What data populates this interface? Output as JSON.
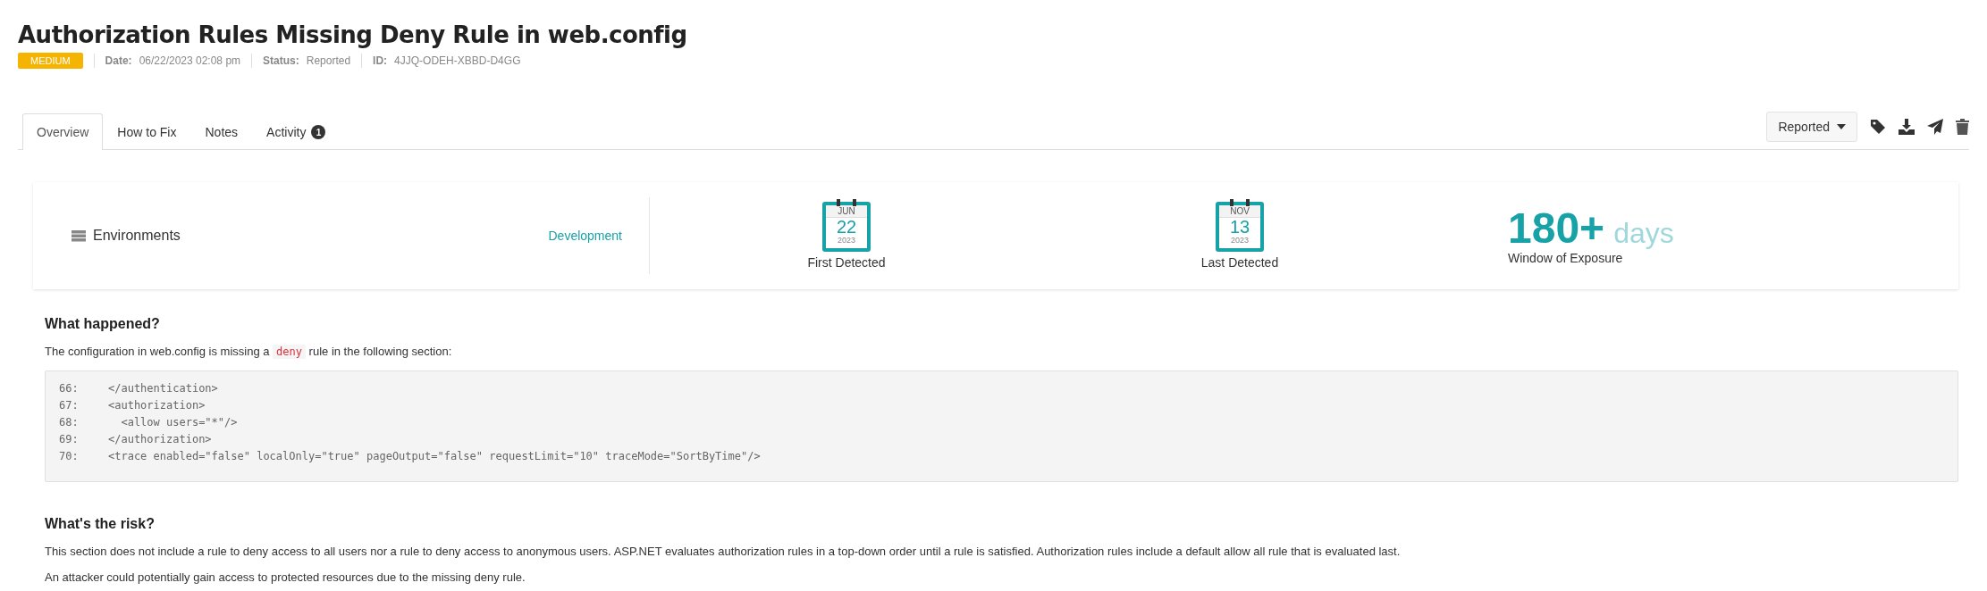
{
  "title": "Authorization Rules Missing Deny Rule in web.config",
  "severity": "MEDIUM",
  "meta": [
    {
      "label": "Date:",
      "value": "06/22/2023 02:08 pm"
    },
    {
      "label": "Status:",
      "value": "Reported"
    },
    {
      "label": "ID:",
      "value": "4JJQ-ODEH-XBBD-D4GG"
    }
  ],
  "tabs": [
    {
      "label": "Overview",
      "selected": true
    },
    {
      "label": "How to Fix",
      "selected": false
    },
    {
      "label": "Notes",
      "selected": false
    },
    {
      "label": "Activity",
      "selected": false,
      "badge": "1"
    }
  ],
  "status_dropdown": "Reported",
  "summary": {
    "environments_label": "Environments",
    "environment": "Development",
    "dates": [
      {
        "month": "JUN",
        "day": "22",
        "year": "2023",
        "label": "First Detected"
      },
      {
        "month": "NOV",
        "day": "13",
        "year": "2023",
        "label": "Last Detected"
      }
    ],
    "exposure": {
      "value": "180+",
      "unit": "days",
      "label": "Window of Exposure"
    }
  },
  "what_happened": {
    "heading": "What happened?",
    "before": "The configuration in web.config is missing a",
    "code": "deny",
    "after": "rule in the following section:",
    "code_lines": [
      {
        "number": "66:",
        "text": "</authentication>"
      },
      {
        "number": "67:",
        "text": "<authorization>"
      },
      {
        "number": "68:",
        "text": "  <allow users=\"*\"/>"
      },
      {
        "number": "69:",
        "text": "</authorization>"
      },
      {
        "number": "70:",
        "text": "<trace enabled=\"false\" localOnly=\"true\" pageOutput=\"false\" requestLimit=\"10\" traceMode=\"SortByTime\"/>"
      }
    ]
  },
  "risk": {
    "heading": "What's the risk?",
    "paragraphs": [
      "This section does not include a rule to deny access to all users nor a rule to deny access to anonymous users. ASP.NET evaluates authorization rules in a top-down order until a rule is satisfied. Authorization rules include a default allow all rule that is evaluated last.",
      "An attacker could potentially gain access to protected resources due to the missing deny rule."
    ]
  }
}
